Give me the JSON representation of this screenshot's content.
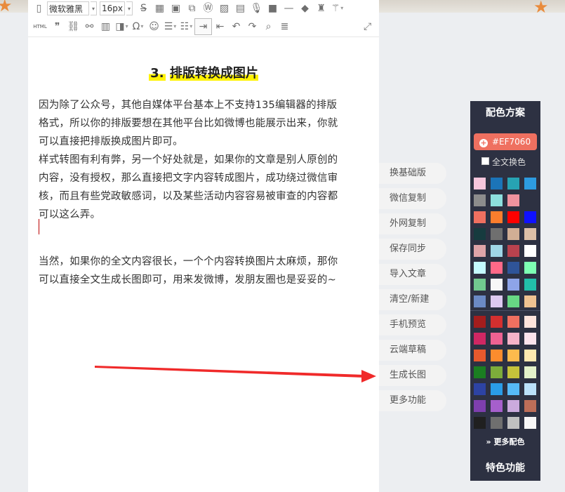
{
  "toolbar": {
    "font_family": "微软雅黑",
    "font_size": "16px",
    "html_label": "HTML"
  },
  "article": {
    "heading_number": "3.",
    "heading_text": "排版转换成图片",
    "para1_lines": [
      "因为除了公众号，其他自媒体平台基本上不支持135编辑器的排版",
      "格式，所以你的排版要想在其他平台比如微博也能展示出来，你就",
      "可以直接把排版换成图片即可。",
      "样式转图有利有弊，另一个好处就是，如果你的文章是别人原创的",
      "内容，没有授权，那么直接把文字内容转成图片，成功绕过微信审",
      "核，而且有些党政敏感词，以及某些活动内容容易被审查的内容都",
      "可以这么弄。"
    ],
    "para3_lines": [
      "当然，如果你的全文内容很长，一个个内容转换图片太麻烦，那你",
      "可以直接全文生成长图即可，用来发微博，发朋友圈也是妥妥的~"
    ]
  },
  "side_menu": [
    "换基础版",
    "微信复制",
    "外网复制",
    "保存同步",
    "导入文章",
    "清空/新建",
    "手机预览",
    "云端草稿",
    "生成长图",
    "更多功能"
  ],
  "color_panel": {
    "title": "配色方案",
    "current_hex": "#EF7060",
    "apply_all_label": "全文换色",
    "more_label": "更多配色",
    "feature_label": "特色功能",
    "swatches_top": [
      [
        "#f7c6dc",
        "#1b74b8",
        "#27a3b3",
        "#2d9be0"
      ],
      [
        "#8c8c8c",
        "#8ddfdd",
        "#f0929e",
        ""
      ],
      [
        "#ef7060",
        "#fb7d2d",
        "#ff0000",
        "#0f11ff"
      ],
      [
        "#173b3f",
        "#6f6f6f",
        "#d1ae95",
        "#dcbfa7"
      ],
      [
        "#dfa4a8",
        "#9fd6e7",
        "#b8424e",
        "#ffffff"
      ],
      [
        "#c4fbff",
        "#ff6988",
        "#2f5498",
        "#7dffb3"
      ],
      [
        "#71c98f",
        "#f7f7f7",
        "#8ea4e8",
        "#22bfa9"
      ],
      [
        "#6b8ac5",
        "#ddc9f1",
        "#67d784",
        "#efc291"
      ]
    ],
    "swatches_bottom": [
      [
        "#a31d1d",
        "#d32f2f",
        "#ef7060",
        "#fde3dc"
      ],
      [
        "#cf2763",
        "#ef6292",
        "#f7b3c8",
        "#fbe3ec"
      ],
      [
        "#e8592d",
        "#fb8c2d",
        "#fcbb4d",
        "#fee8b0"
      ],
      [
        "#1b7e21",
        "#7dac3a",
        "#c5c23a",
        "#e3f1c9"
      ],
      [
        "#2d43a3",
        "#2a9ce7",
        "#56b9f6",
        "#bbe1fa"
      ],
      [
        "#7e3fae",
        "#a65fcc",
        "#cbaadd",
        "#bd6e58"
      ],
      [
        "#202020",
        "#6f6f6f",
        "#c0c0c0",
        "#f7f7f7"
      ]
    ]
  },
  "colors": {
    "annotation_arrow": "#f02a2a",
    "panel_bg": "#2d3142",
    "heading_highlight": "#fff200"
  }
}
